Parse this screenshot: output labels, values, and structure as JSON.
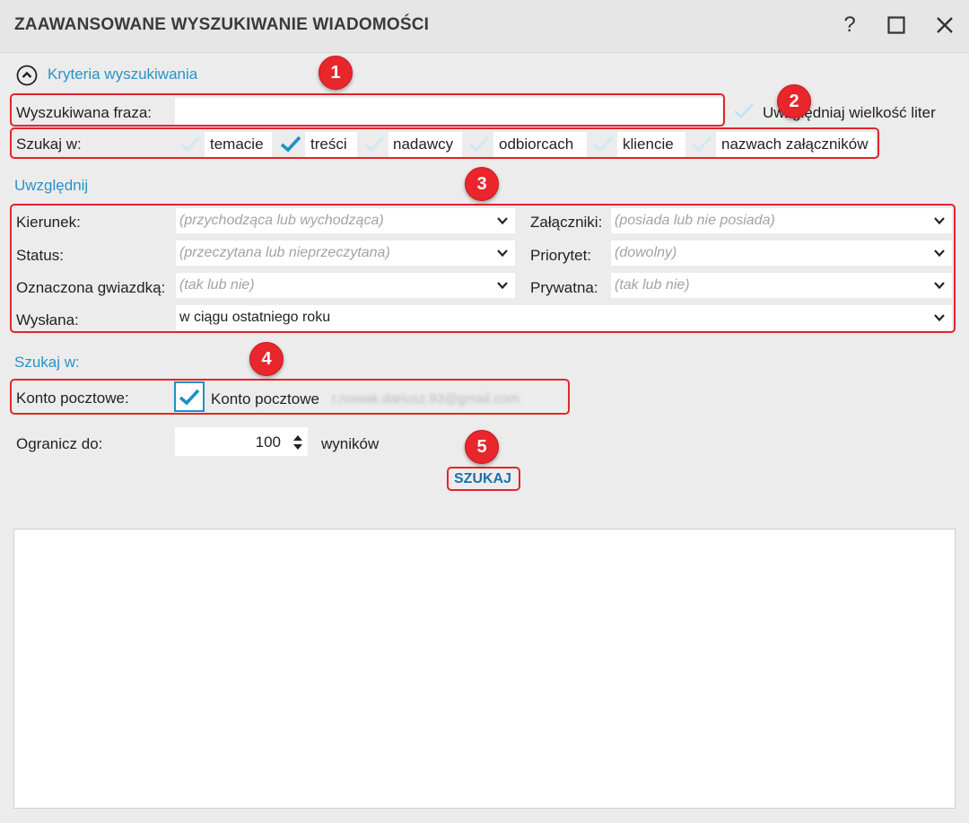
{
  "window": {
    "title": "ZAAWANSOWANE WYSZUKIWANIE WIADOMOŚCI",
    "help_label": "?",
    "maximize_label": "☐",
    "close_label": "✕"
  },
  "criteria": {
    "section_label": "Kryteria wyszukiwania",
    "phrase_label": "Wyszukiwana fraza:",
    "phrase_value": "",
    "case_label": "Uwzględniaj wielkość liter",
    "case_checked": false,
    "search_in_label": "Szukaj w:",
    "search_in_options": [
      {
        "label": "temacie",
        "checked": false
      },
      {
        "label": "treści",
        "checked": true
      },
      {
        "label": "nadawcy",
        "checked": false
      },
      {
        "label": "odbiorcach",
        "checked": false
      },
      {
        "label": "kliencie",
        "checked": false
      },
      {
        "label": "nazwach załączników",
        "checked": false
      }
    ]
  },
  "include": {
    "section_label": "Uwzględnij",
    "direction_label": "Kierunek:",
    "direction_placeholder": "(przychodząca lub wychodząca)",
    "attachments_label": "Załączniki:",
    "attachments_placeholder": "(posiada lub nie posiada)",
    "status_label": "Status:",
    "status_placeholder": "(przeczytana lub nieprzeczytana)",
    "priority_label": "Priorytet:",
    "priority_placeholder": "(dowolny)",
    "starred_label": "Oznaczona gwiazdką:",
    "starred_placeholder": "(tak lub nie)",
    "private_label": "Prywatna:",
    "private_placeholder": "(tak lub nie)",
    "sent_label": "Wysłana:",
    "sent_value": "w ciągu ostatniego roku"
  },
  "search_in": {
    "section_label": "Szukaj w:",
    "account_label": "Konto pocztowe:",
    "account_checked": true,
    "account_option_label": "Konto pocztowe",
    "account_email": "r.nowak.dariusz.93@gmail.com"
  },
  "limit": {
    "label": "Ogranicz do:",
    "value": "100",
    "unit": "wyników"
  },
  "search_button_label": "SZUKAJ",
  "annotations": [
    "1",
    "2",
    "3",
    "4",
    "5"
  ],
  "colors": {
    "accent": "#2a93c9",
    "annotation_red": "#e3242b",
    "check_blue": "#1e90c8"
  }
}
